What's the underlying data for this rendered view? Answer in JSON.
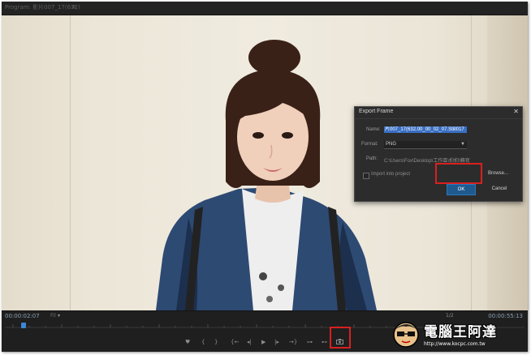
{
  "tab": {
    "label": "Program: 影片007_17(632)",
    "menu_icon": "≡"
  },
  "dialog": {
    "title": "Export Frame",
    "close_icon": "✕",
    "name_label": "Name:",
    "name_value": "片007_17(632.00_00_02_07.Still017",
    "format_label": "Format:",
    "format_value": "PNG",
    "path_label": "Path:",
    "path_value": "C:\\Users\\Fox\\Desktop\\工作區\\拍拍\\轉寫",
    "import_label": "Import into project",
    "browse_label": "Browse...",
    "ok_label": "OK",
    "cancel_label": "Cancel"
  },
  "player": {
    "timecode_current": "00:00:02:07",
    "timecode_duration": "00:00:55:13",
    "fit_label": "Fit",
    "resolution_label": "1/2"
  },
  "controls": {
    "marker_icon": "marker-icon",
    "in_point": "{",
    "out_point": "}",
    "go_to_in": "{←",
    "step_back": "◂|",
    "play": "▶",
    "step_forward": "|▸",
    "go_to_out": "→}",
    "insert_icon": "insert-icon",
    "overwrite_icon": "overwrite-icon",
    "export_frame_icon": "camera-icon"
  },
  "watermark": {
    "text": "電腦王阿達",
    "url": "http://www.kocpc.com.tw"
  },
  "colors": {
    "highlight": "#d9201f",
    "accent_blue": "#1f5a8f",
    "selection": "#3a6fc4"
  }
}
